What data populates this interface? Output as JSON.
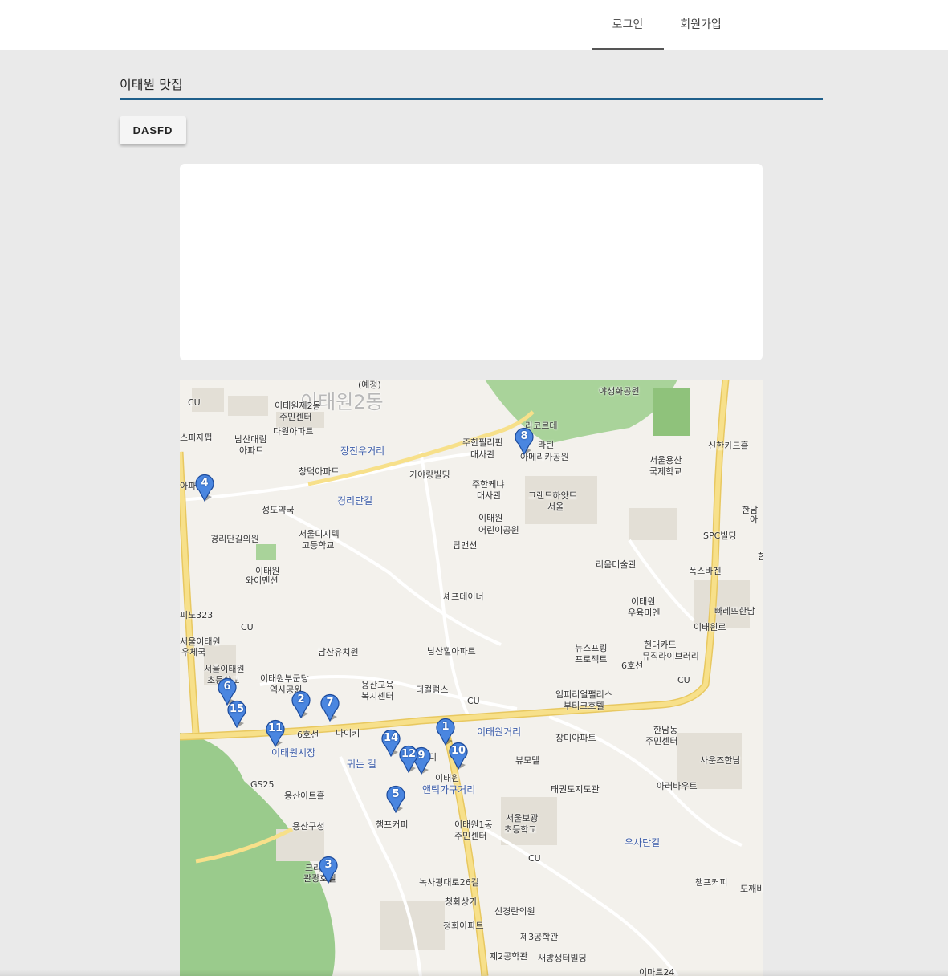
{
  "nav": {
    "login": "로그인",
    "signup": "회원가입"
  },
  "search": {
    "value": "이태원 맛집"
  },
  "button": {
    "label": "DASFD"
  },
  "map": {
    "labels": [
      {
        "text": "이태원2동",
        "kind": "district"
      },
      {
        "text": "(예정)"
      },
      {
        "text": "이태원제2동"
      },
      {
        "text": "주민센터"
      },
      {
        "text": "야생화공원"
      },
      {
        "text": "라코르테"
      },
      {
        "text": "남산대림"
      },
      {
        "text": "아파트"
      },
      {
        "text": "다원아파트"
      },
      {
        "text": "장진우거리",
        "kind": "street"
      },
      {
        "text": "주한필리핀"
      },
      {
        "text": "대사관"
      },
      {
        "text": "라틴"
      },
      {
        "text": "아메리카공원"
      },
      {
        "text": "서울용산"
      },
      {
        "text": "국제학교"
      },
      {
        "text": "신한카드홀"
      },
      {
        "text": "창덕아파트"
      },
      {
        "text": "가야랑빌딩"
      },
      {
        "text": "경리단길",
        "kind": "street"
      },
      {
        "text": "성도약국"
      },
      {
        "text": "주한케냐"
      },
      {
        "text": "대사관"
      },
      {
        "text": "그랜드하얏트"
      },
      {
        "text": "서울"
      },
      {
        "text": "서울디지텍"
      },
      {
        "text": "고등학교"
      },
      {
        "text": "경리단길의원"
      },
      {
        "text": "이태원"
      },
      {
        "text": "와이맨션"
      },
      {
        "text": "SPC빌딩"
      },
      {
        "text": "탑맨션"
      },
      {
        "text": "이태원"
      },
      {
        "text": "어린이공원"
      },
      {
        "text": "리움미술관"
      },
      {
        "text": "폭스바겐"
      },
      {
        "text": "셰프테이너"
      },
      {
        "text": "피노323"
      },
      {
        "text": "CU"
      },
      {
        "text": "이태원"
      },
      {
        "text": "우육미엔"
      },
      {
        "text": "빠레뜨한남"
      },
      {
        "text": "서울이태원"
      },
      {
        "text": "우체국"
      },
      {
        "text": "남산유치원"
      },
      {
        "text": "남산힐아파트"
      },
      {
        "text": "뉴스프링"
      },
      {
        "text": "프로젝트"
      },
      {
        "text": "현대카드"
      },
      {
        "text": "뮤직라이브러리"
      },
      {
        "text": "서울이태원"
      },
      {
        "text": "초등학교"
      },
      {
        "text": "이태원부군당"
      },
      {
        "text": "역사공원"
      },
      {
        "text": "용산교육"
      },
      {
        "text": "복지센터"
      },
      {
        "text": "더컬럼스"
      },
      {
        "text": "CU"
      },
      {
        "text": "임피리얼팰리스"
      },
      {
        "text": "부티크호텔"
      },
      {
        "text": "CU"
      },
      {
        "text": "한남동"
      },
      {
        "text": "주민센터"
      },
      {
        "text": "나이키"
      },
      {
        "text": "이태원거리",
        "kind": "street"
      },
      {
        "text": "장미아파트"
      },
      {
        "text": "이태원시장",
        "kind": "street"
      },
      {
        "text": "퀴논 길",
        "kind": "street"
      },
      {
        "text": "이태원"
      },
      {
        "text": "앤틱가구거리",
        "kind": "street"
      },
      {
        "text": "뷰모텔"
      },
      {
        "text": "사운즈한남"
      },
      {
        "text": "GS25"
      },
      {
        "text": "태권도지도관"
      },
      {
        "text": "아러바우트"
      },
      {
        "text": "용산아트홀"
      },
      {
        "text": "용산구청"
      },
      {
        "text": "챔프커피"
      },
      {
        "text": "이태원1동"
      },
      {
        "text": "주민센터"
      },
      {
        "text": "서울보광"
      },
      {
        "text": "초등학교"
      },
      {
        "text": "우사단길",
        "kind": "street"
      },
      {
        "text": "CU"
      },
      {
        "text": "크라"
      },
      {
        "text": "관광호텔"
      },
      {
        "text": "챔프커피"
      },
      {
        "text": "도깨비"
      },
      {
        "text": "청화상가"
      },
      {
        "text": "신경란의원"
      },
      {
        "text": "청화아파트"
      },
      {
        "text": "제3공학관"
      },
      {
        "text": "제2공학관"
      },
      {
        "text": "새방생터빌딩"
      },
      {
        "text": "이마트24"
      },
      {
        "text": "CU"
      },
      {
        "text": "스피자펍"
      },
      {
        "text": "아파"
      },
      {
        "text": "한남"
      },
      {
        "text": "아"
      },
      {
        "text": "한"
      },
      {
        "text": "6호선"
      },
      {
        "text": "녹사평대로26길"
      },
      {
        "text": "이태원로"
      },
      {
        "text": "6호선"
      },
      {
        "text": "디"
      }
    ],
    "markers": [
      "1",
      "2",
      "3",
      "4",
      "5",
      "6",
      "7",
      "8",
      "9",
      "10",
      "11",
      "12",
      "14",
      "15"
    ],
    "colors": {
      "marker": "#4a86e0",
      "park": "#9acb8c",
      "road_major": "#f7e08a",
      "background": "#f3f1ec"
    }
  }
}
